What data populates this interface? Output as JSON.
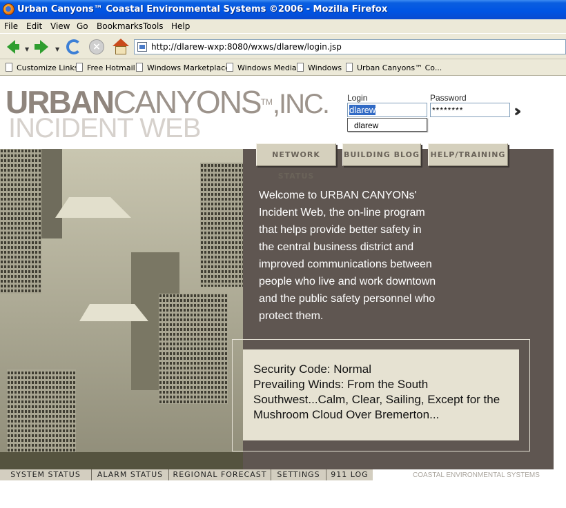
{
  "window": {
    "title": "Urban Canyons™ Coastal Environmental Systems ©2006 - Mozilla Firefox"
  },
  "menu": [
    "File",
    "Edit",
    "View",
    "Go",
    "Bookmarks",
    "Tools",
    "Help"
  ],
  "address": {
    "url": "http://dlarew-wxp:8080/wxws/dlarew/login.jsp"
  },
  "bookmarks": [
    "Customize Links",
    "Free Hotmail",
    "Windows Marketplace",
    "Windows Media",
    "Windows",
    "Urban Canyons™ Co..."
  ],
  "logo": {
    "brand_bold": "URBAN",
    "brand_light": "CANYONS",
    "tm": "TM",
    "suffix": ",INC.",
    "subtitle": "INCIDENT WEB"
  },
  "login": {
    "login_label": "Login",
    "password_label": "Password",
    "login_value": "dlarew",
    "password_value": "********",
    "autocomplete_option": "dlarew",
    "submit_glyph": "››"
  },
  "tabs": [
    "NETWORK STATUS",
    "BUILDING BLOG",
    "HELP/TRAINING"
  ],
  "welcome_text": "Welcome to URBAN CANYONs' Incident Web, the on-line program that helps provide better safety in the central business district and improved communications between people who live and work downtown and the public safety personnel who protect them.",
  "status": {
    "line1": "Security Code: Normal",
    "line2": "Prevailing Winds: From the South Southwest...Calm, Clear, Sailing, Except for the Mushroom Cloud Over Bremerton..."
  },
  "footer_tabs": [
    "SYSTEM STATUS",
    "ALARM STATUS",
    "REGIONAL FORECAST",
    "SETTINGS",
    "911 LOG"
  ],
  "footer_brand": "COASTAL ENVIRONMENTAL SYSTEMS",
  "colors": {
    "panel": "#5f5651",
    "tab_bg": "#d5d0bd",
    "status_bg": "#e6e2d2",
    "titlebar": "#0054e3"
  }
}
